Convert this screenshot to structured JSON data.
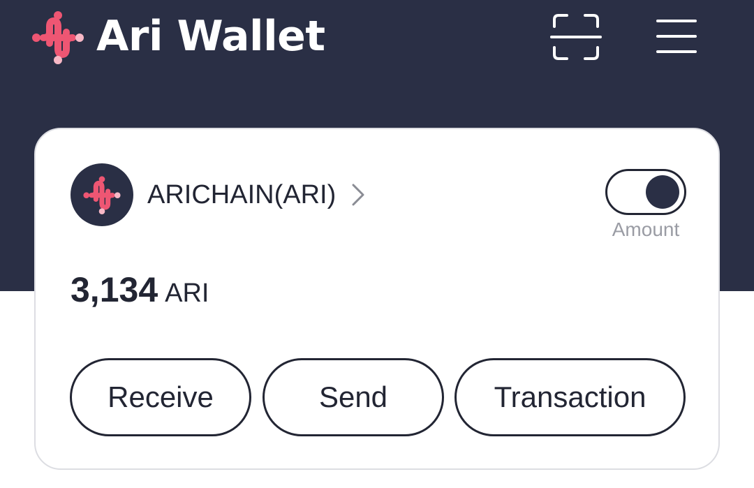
{
  "header": {
    "title": "Ari Wallet",
    "logo_icon": "ari-dots-logo",
    "scan_icon": "scan-qr-icon",
    "menu_icon": "hamburger-menu-icon"
  },
  "card": {
    "token": {
      "name": "ARICHAIN(ARI)",
      "avatar_icon": "ari-dots-logo"
    },
    "toggle": {
      "label": "Amount",
      "state": "on"
    },
    "balance": {
      "amount": "3,134",
      "unit": "ARI"
    },
    "actions": {
      "receive_label": "Receive",
      "send_label": "Send",
      "transaction_label": "Transaction"
    }
  },
  "colors": {
    "header_bg": "#2a2f45",
    "accent_pink": "#ee5673",
    "accent_light_pink": "#f7b8c6",
    "text_dark": "#222533",
    "muted": "#9a9ca4"
  }
}
